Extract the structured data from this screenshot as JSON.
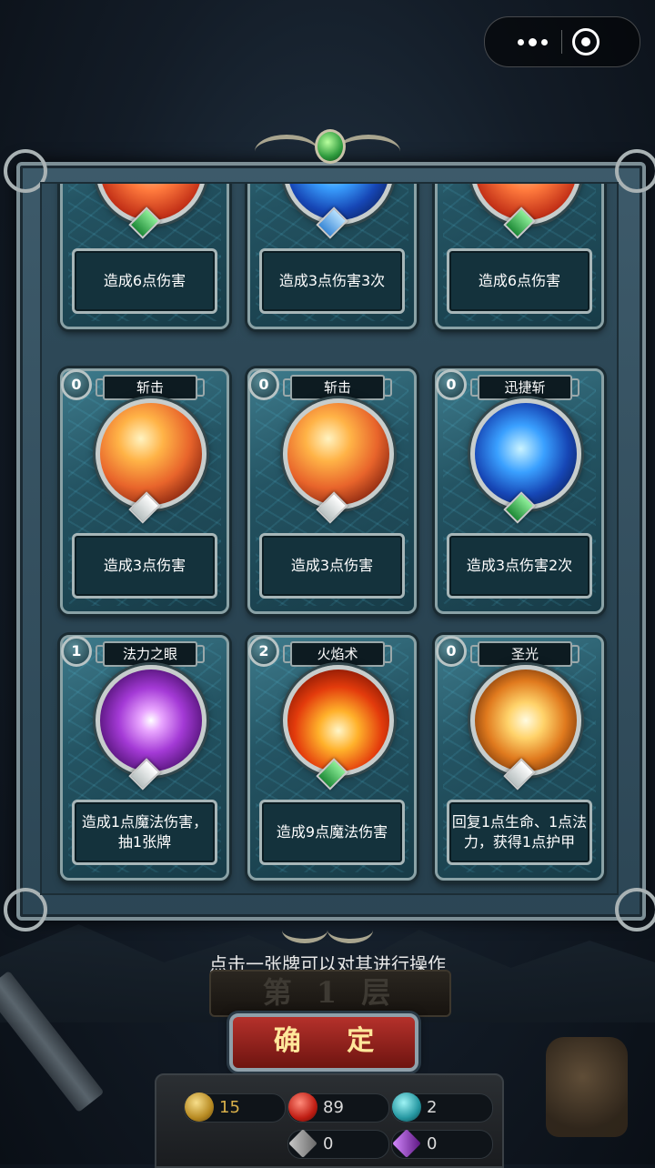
{
  "top_capsule": {
    "more_icon": "more-dots-icon",
    "close_icon": "close-target-icon"
  },
  "cards": [
    {
      "cost": "",
      "name": "",
      "art": "orange",
      "gem": "green",
      "desc": "造成6点伤害"
    },
    {
      "cost": "",
      "name": "",
      "art": "blue-slash",
      "gem": "blue",
      "desc": "造成3点伤害3次"
    },
    {
      "cost": "",
      "name": "",
      "art": "orange",
      "gem": "green",
      "desc": "造成6点伤害"
    },
    {
      "cost": "0",
      "name": "斩击",
      "art": "fire-slash",
      "gem": "white",
      "desc": "造成3点伤害"
    },
    {
      "cost": "0",
      "name": "斩击",
      "art": "fire-slash",
      "gem": "white",
      "desc": "造成3点伤害"
    },
    {
      "cost": "0",
      "name": "迅捷斩",
      "art": "blue-slash",
      "gem": "green",
      "desc": "造成3点伤害2次"
    },
    {
      "cost": "1",
      "name": "法力之眼",
      "art": "eye",
      "gem": "white",
      "desc": "造成1点魔法伤害，抽1张牌"
    },
    {
      "cost": "2",
      "name": "火焰术",
      "art": "flame",
      "gem": "green",
      "desc": "造成9点魔法伤害"
    },
    {
      "cost": "0",
      "name": "圣光",
      "art": "holy",
      "gem": "white",
      "desc": "回复1点生命、1点法力，获得1点护甲"
    }
  ],
  "hint_text": "点击一张牌可以对其进行操作",
  "floor_text": "第 1 层",
  "confirm_label": "确 定",
  "stats": {
    "gold": "15",
    "hp": "89",
    "mana": "2",
    "armor": "0",
    "special": "0"
  }
}
